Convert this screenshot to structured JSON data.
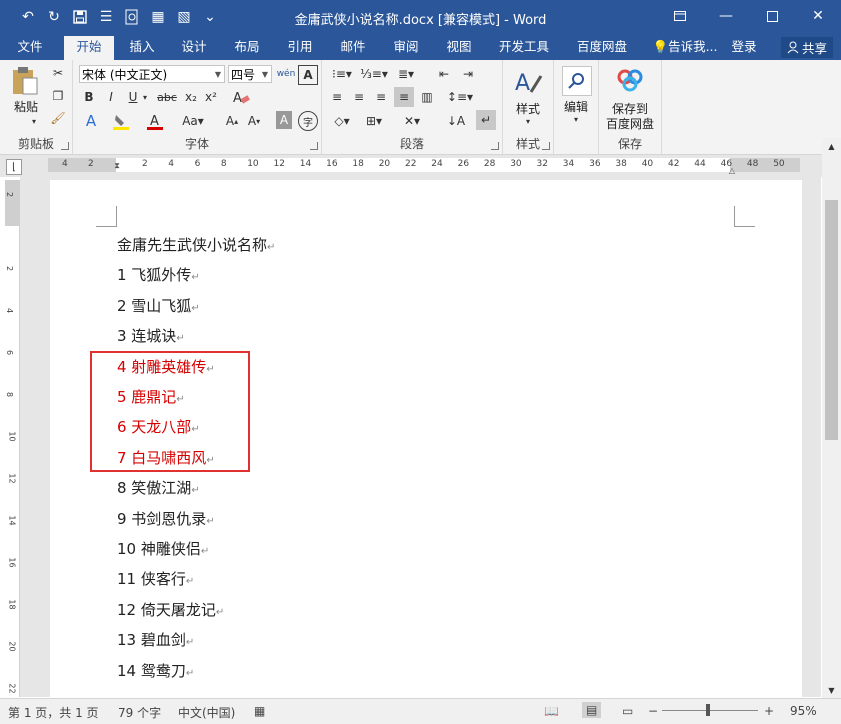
{
  "titlebar": {
    "title": "金庸武侠小说名称.docx [兼容模式] - Word",
    "qat": [
      "undo-icon",
      "redo-icon",
      "save-icon",
      "touch-mode-icon",
      "print-preview-icon",
      "new-doc-icon",
      "format-icon",
      "customize-qat-icon"
    ],
    "window_icons": [
      "ribbon-display-icon",
      "minimize-icon",
      "maximize-icon",
      "close-icon"
    ]
  },
  "tabs": [
    "文件",
    "开始",
    "插入",
    "设计",
    "布局",
    "引用",
    "邮件",
    "审阅",
    "视图",
    "开发工具",
    "百度网盘"
  ],
  "tell_me": "告诉我...",
  "login": "登录",
  "share": "共享",
  "ribbon": {
    "clipboard": {
      "label": "剪贴板",
      "paste": "粘贴"
    },
    "font": {
      "label": "字体",
      "font_name": "宋体 (中文正文)",
      "font_size": "四号",
      "buttons": [
        "B",
        "I",
        "U",
        "abc",
        "x₂",
        "x²",
        "A",
        "A"
      ]
    },
    "paragraph": {
      "label": "段落"
    },
    "styles": {
      "label": "样式",
      "button": "样式"
    },
    "editing": {
      "button": "编辑"
    },
    "save": {
      "label": "保存",
      "button_line1": "保存到",
      "button_line2": "百度网盘"
    }
  },
  "ruler": {
    "h": [
      "4",
      "2",
      "2",
      "4",
      "6",
      "8",
      "10",
      "12",
      "14",
      "16",
      "18",
      "20",
      "22",
      "24",
      "26",
      "28",
      "30",
      "32",
      "34",
      "36",
      "38",
      "40",
      "42",
      "44",
      "46",
      "48",
      "50"
    ],
    "v": [
      "2",
      "2",
      "4",
      "6",
      "8",
      "10",
      "12",
      "14",
      "16",
      "18",
      "20",
      "22"
    ]
  },
  "document": {
    "heading": "金庸先生武侠小说名称",
    "items": [
      {
        "text": "1 飞狐外传",
        "highlight": false
      },
      {
        "text": "2 雪山飞狐",
        "highlight": false
      },
      {
        "text": "3 连城诀",
        "highlight": false
      },
      {
        "text": "4 射雕英雄传",
        "highlight": true
      },
      {
        "text": "5 鹿鼎记",
        "highlight": true
      },
      {
        "text": "6 天龙八部",
        "highlight": true
      },
      {
        "text": "7 白马啸西风",
        "highlight": true
      },
      {
        "text": "8 笑傲江湖",
        "highlight": false
      },
      {
        "text": "9 书剑恩仇录",
        "highlight": false
      },
      {
        "text": "10 神雕侠侣",
        "highlight": false
      },
      {
        "text": "11 侠客行",
        "highlight": false
      },
      {
        "text": "12 倚天屠龙记",
        "highlight": false
      },
      {
        "text": "13 碧血剑",
        "highlight": false
      },
      {
        "text": "14 鸳鸯刀",
        "highlight": false
      }
    ],
    "highlight_color": "#d60000",
    "box_color": "#e03030"
  },
  "status": {
    "page": "第 1 页，共 1 页",
    "words": "79 个字",
    "lang": "中文(中国)",
    "zoom": "95%"
  },
  "colors": {
    "brand": "#2b579a"
  }
}
